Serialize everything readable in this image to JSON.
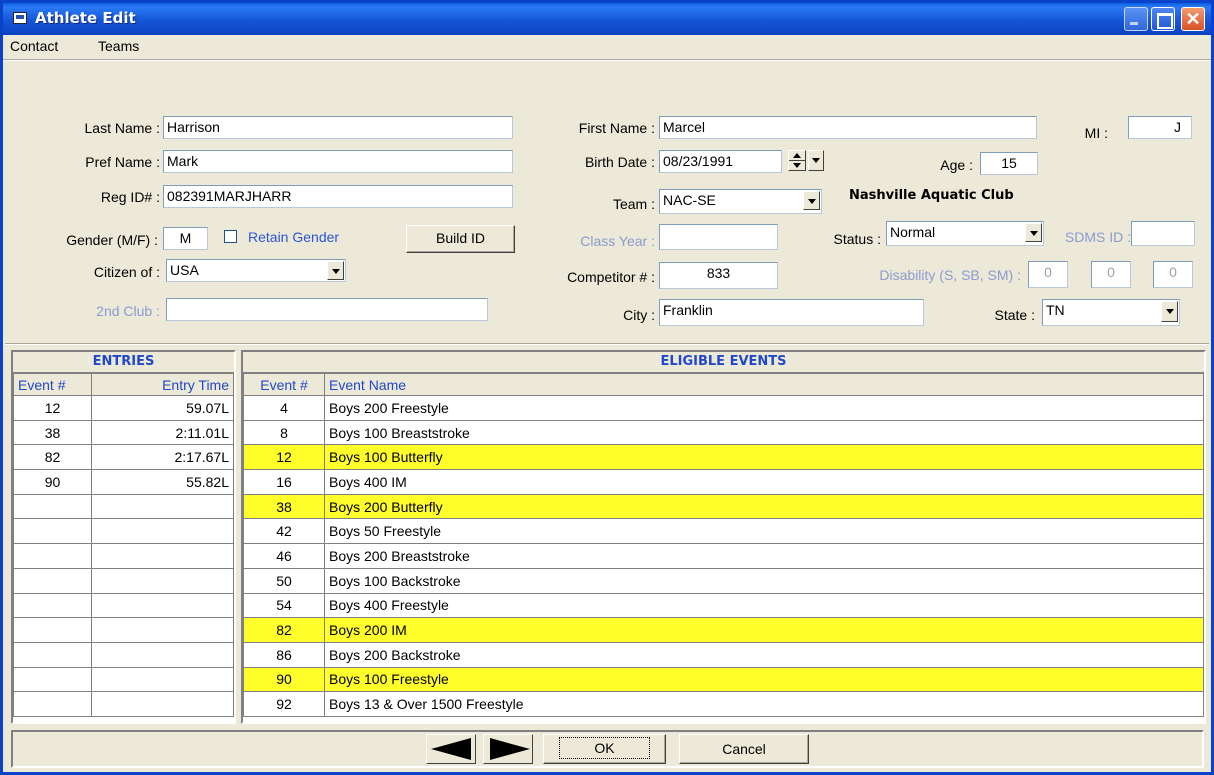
{
  "window": {
    "title": "Athlete Edit",
    "close_glyph": "✕"
  },
  "menu": {
    "items": [
      "Contact",
      "Teams"
    ]
  },
  "form": {
    "last_name": {
      "label": "Last Name :",
      "value": "Harrison"
    },
    "pref_name": {
      "label": "Pref Name :",
      "value": "Mark"
    },
    "reg_id": {
      "label": "Reg ID# :",
      "value": "082391MARJHARR"
    },
    "gender": {
      "label": "Gender (M/F) :",
      "value": "M"
    },
    "retain_gender": {
      "label": "Retain Gender"
    },
    "build_id": {
      "label": "Build ID"
    },
    "citizen_of": {
      "label": "Citizen of :",
      "value": "USA"
    },
    "second_club": {
      "label": "2nd Club :",
      "value": ""
    },
    "first_name": {
      "label": "First Name :",
      "value": "Marcel"
    },
    "mi": {
      "label": "MI :",
      "value": "J"
    },
    "birth_date": {
      "label": "Birth Date :",
      "value": "08/23/1991"
    },
    "age": {
      "label": "Age :",
      "value": "15"
    },
    "team": {
      "label": "Team :",
      "value": "NAC-SE",
      "name": "Nashville Aquatic Club"
    },
    "class_year": {
      "label": "Class Year :",
      "value": ""
    },
    "status": {
      "label": "Status :",
      "value": "Normal"
    },
    "sdms_id": {
      "label": "SDMS ID :",
      "value": ""
    },
    "competitor": {
      "label": "Competitor # :",
      "value": "833"
    },
    "disability": {
      "label": "Disability (S, SB, SM) :",
      "values": [
        "0",
        "0",
        "0"
      ]
    },
    "city": {
      "label": "City :",
      "value": "Franklin"
    },
    "state": {
      "label": "State :",
      "value": "TN"
    }
  },
  "entries": {
    "title": "ENTRIES",
    "columns": [
      "Event #",
      "Entry Time"
    ],
    "rows": [
      [
        "12",
        "59.07L"
      ],
      [
        "38",
        "2:11.01L"
      ],
      [
        "82",
        "2:17.67L"
      ],
      [
        "90",
        "55.82L"
      ],
      [
        "",
        ""
      ],
      [
        "",
        ""
      ],
      [
        "",
        ""
      ],
      [
        "",
        ""
      ],
      [
        "",
        ""
      ],
      [
        "",
        ""
      ],
      [
        "",
        ""
      ],
      [
        "",
        ""
      ],
      [
        "",
        ""
      ]
    ]
  },
  "eligible": {
    "title": "ELIGIBLE EVENTS",
    "columns": [
      "Event #",
      "Event Name"
    ],
    "highlight_color": "#fffe2a",
    "rows": [
      {
        "num": "4",
        "name": "Boys 200 Freestyle",
        "entered": false
      },
      {
        "num": "8",
        "name": "Boys 100 Breaststroke",
        "entered": false
      },
      {
        "num": "12",
        "name": "Boys 100 Butterfly",
        "entered": true
      },
      {
        "num": "16",
        "name": "Boys 400 IM",
        "entered": false
      },
      {
        "num": "38",
        "name": "Boys 200 Butterfly",
        "entered": true
      },
      {
        "num": "42",
        "name": "Boys 50 Freestyle",
        "entered": false
      },
      {
        "num": "46",
        "name": "Boys 200 Breaststroke",
        "entered": false
      },
      {
        "num": "50",
        "name": "Boys 100 Backstroke",
        "entered": false
      },
      {
        "num": "54",
        "name": "Boys 400 Freestyle",
        "entered": false
      },
      {
        "num": "82",
        "name": "Boys 200 IM",
        "entered": true
      },
      {
        "num": "86",
        "name": "Boys 200 Backstroke",
        "entered": false
      },
      {
        "num": "90",
        "name": "Boys 100 Freestyle",
        "entered": true
      },
      {
        "num": "92",
        "name": "Boys 13 & Over 1500 Freestyle",
        "entered": false
      }
    ]
  },
  "footer": {
    "ok": "OK",
    "cancel": "Cancel"
  }
}
